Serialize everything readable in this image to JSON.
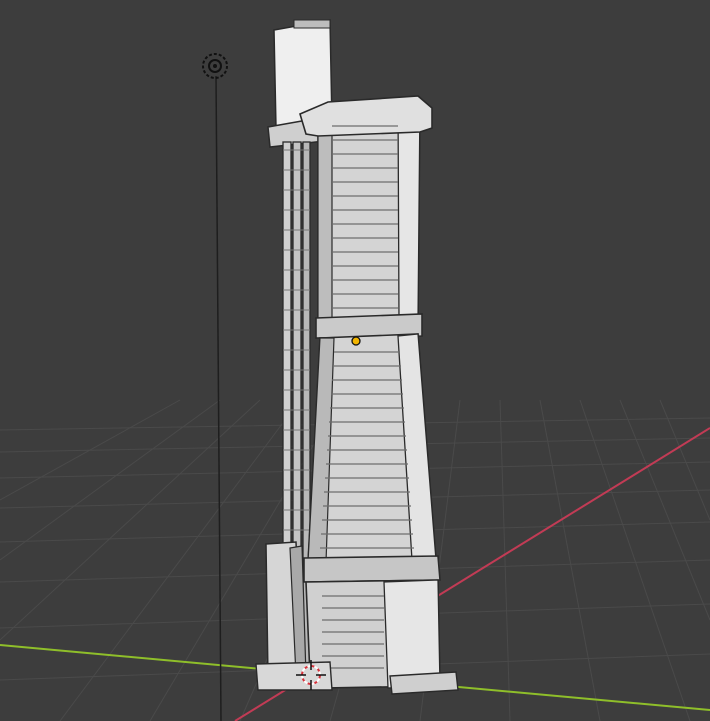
{
  "viewport": {
    "background_color": "#3d3d3d",
    "grid_line_color": "#4a4a4a",
    "x_axis_color": "#c23b55",
    "y_axis_color": "#8fbf2a",
    "z_axis_color": "#1e1e1e"
  },
  "model": {
    "face_color": "#d4d4d4",
    "shadow_color": "#8f8f8f",
    "edge_color": "#2a2a2a",
    "highlight_color": "#efefef"
  },
  "icons": {
    "light": "light-icon",
    "origin": "object-origin-icon",
    "cursor": "3d-cursor-icon"
  },
  "origin_color": "#f2b500",
  "cursor_color": "#d8303a"
}
